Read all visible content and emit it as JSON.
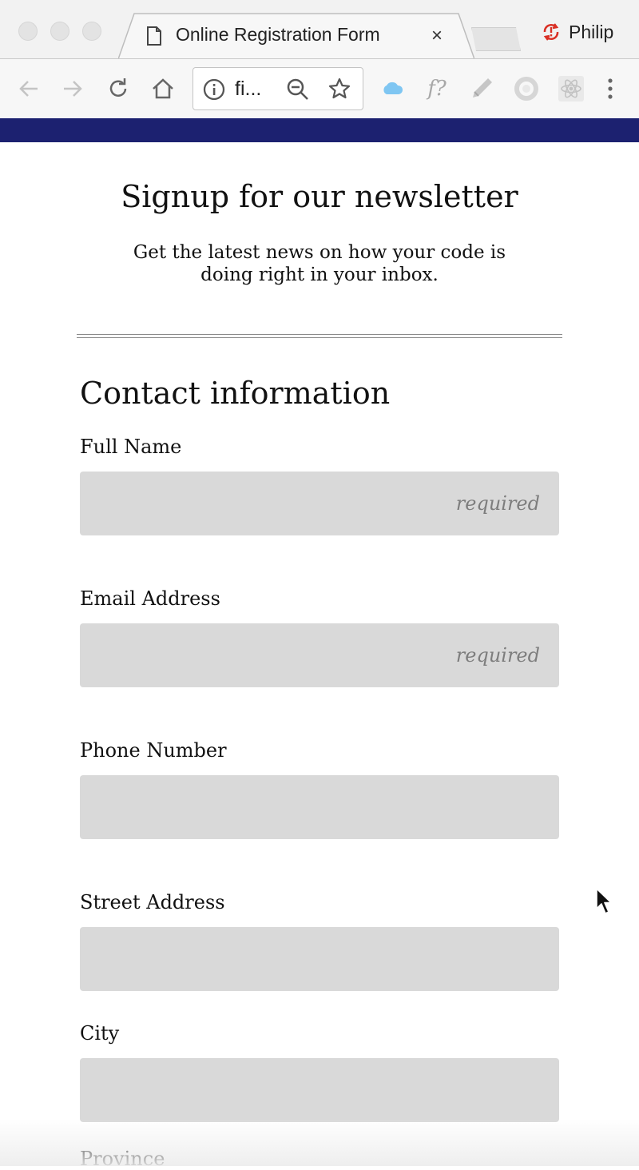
{
  "browser": {
    "tab_title": "Online Registration Form",
    "tab_close": "×",
    "profile_name": "Philip",
    "url": "fi...",
    "icons": {
      "back": "arrow-left-icon",
      "forward": "arrow-right-icon",
      "reload": "reload-icon",
      "home": "home-icon",
      "info": "info-icon",
      "zoom": "zoom-out-icon",
      "bookmark": "star-icon",
      "ext_cloud": "cloud-icon",
      "ext_fonts": "font-question-icon",
      "ext_pen": "pen-icon",
      "ext_circle": "circle-icon",
      "ext_react": "react-icon",
      "menu": "kebab-menu-icon"
    },
    "extension_fonts_label": "f?"
  },
  "colors": {
    "accent_bar": "#1c2170",
    "input_bg": "#d9d9d9",
    "profile_alert": "#d93025"
  },
  "page": {
    "heading": "Signup for our newsletter",
    "subheading": "Get the latest news on how your code is doing right in your inbox.",
    "section_title": "Contact information",
    "fields": [
      {
        "label": "Full Name",
        "placeholder": "required"
      },
      {
        "label": "Email Address",
        "placeholder": "required"
      },
      {
        "label": "Phone Number",
        "placeholder": ""
      },
      {
        "label": "Street Address",
        "placeholder": ""
      },
      {
        "label": "City",
        "placeholder": ""
      },
      {
        "label": "Province",
        "placeholder": ""
      }
    ]
  }
}
